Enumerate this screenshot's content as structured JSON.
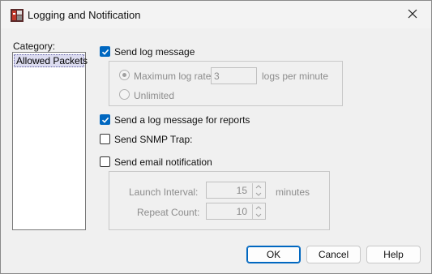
{
  "window": {
    "title": "Logging and Notification",
    "app_icon": "firewall-app-icon",
    "close_icon": "close-icon"
  },
  "category": {
    "label": "Category:",
    "items": [
      {
        "label": "Allowed Packets",
        "selected": true
      }
    ]
  },
  "log": {
    "send_log_label": "Send log message",
    "send_log_checked": true,
    "max_rate_label": "Maximum log rate:",
    "max_rate_value": "3",
    "max_rate_selected": true,
    "logs_per_minute_label": "logs per minute",
    "unlimited_label": "Unlimited",
    "unlimited_selected": false
  },
  "reports": {
    "label": "Send a log message for reports",
    "checked": true
  },
  "snmp": {
    "label": "Send SNMP Trap:",
    "checked": false
  },
  "email": {
    "label": "Send email notification",
    "checked": false,
    "launch_interval_label": "Launch Interval:",
    "launch_interval_value": "15",
    "minutes_label": "minutes",
    "repeat_count_label": "Repeat Count:",
    "repeat_count_value": "10"
  },
  "buttons": {
    "ok": "OK",
    "cancel": "Cancel",
    "help": "Help"
  },
  "colors": {
    "accent": "#0067c0",
    "selection": "#dcdcf0",
    "disabled_text": "#8c8c8c"
  }
}
